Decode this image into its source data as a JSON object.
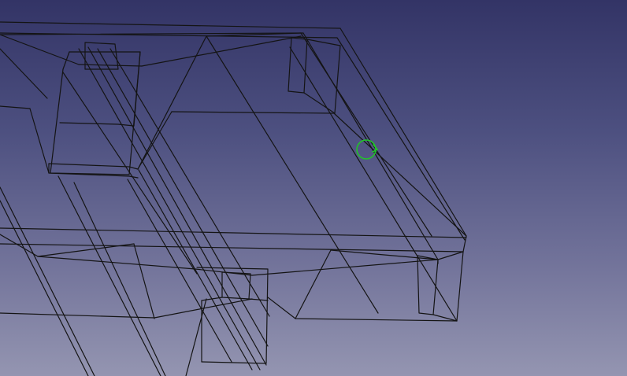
{
  "viewport": {
    "background_top": "#333466",
    "background_bottom": "#9495b1",
    "edge_color": "#141414",
    "cursor_color": "#22c22a",
    "cursor_icon": "rotate-cursor-icon"
  }
}
